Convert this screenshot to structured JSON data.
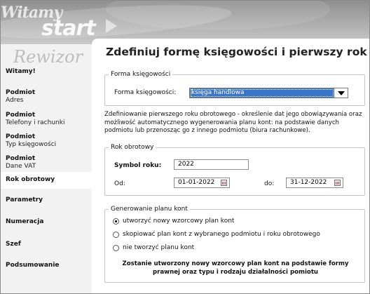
{
  "banner": {
    "word1": "Witamy",
    "word2": "start",
    "brand": "Rewizor"
  },
  "sidebar": {
    "items": [
      {
        "title": "Witamy!",
        "sub": ""
      },
      {
        "title": "Podmiot",
        "sub": "Adres"
      },
      {
        "title": "Podmiot",
        "sub": "Telefony i rachunki"
      },
      {
        "title": "Podmiot",
        "sub": "Typ księgowości"
      },
      {
        "title": "Podmiot",
        "sub": "Dane VAT"
      },
      {
        "title": "Rok obrotowy",
        "sub": ""
      },
      {
        "title": "Parametry",
        "sub": ""
      },
      {
        "title": "Numeracja",
        "sub": ""
      },
      {
        "title": "Szef",
        "sub": ""
      },
      {
        "title": "Podsumowanie",
        "sub": ""
      }
    ],
    "active_index": 5
  },
  "main": {
    "title": "Zdefiniuj formę księgowości i pierwszy rok",
    "forma_group": {
      "legend": "Forma księgowości",
      "label": "Forma księgowości:",
      "selected": "księga handlowa"
    },
    "description": "Zdefiniowanie pierwszego roku obrotowego - określenie dat jego obowiązywania oraz możliwość automatycznego wygenerowania planu kont: na podstawie danych podmiotu lub przenosząc go z innego podmiotu (biura rachunkowe).",
    "rok_group": {
      "legend": "Rok obrotowy",
      "symbol_label": "Symbol roku:",
      "symbol_value": "2022",
      "od_label": "Od:",
      "od_value": "01-01-2022",
      "do_label": "do:",
      "do_value": "31-12-2022"
    },
    "plan_group": {
      "legend": "Generowanie planu kont",
      "options": [
        {
          "label": "utworzyć nowy wzorcowy plan kont",
          "selected": true
        },
        {
          "label": "skopiować plan kont z wybranego podmiotu i roku obrotowego",
          "selected": false
        },
        {
          "label": "nie tworzyć planu kont",
          "selected": false
        }
      ],
      "note": "Zostanie utworzony nowy wzorcowy plan kont na podstawie formy prawnej oraz typu i rodzaju działalności pomiotu"
    }
  }
}
